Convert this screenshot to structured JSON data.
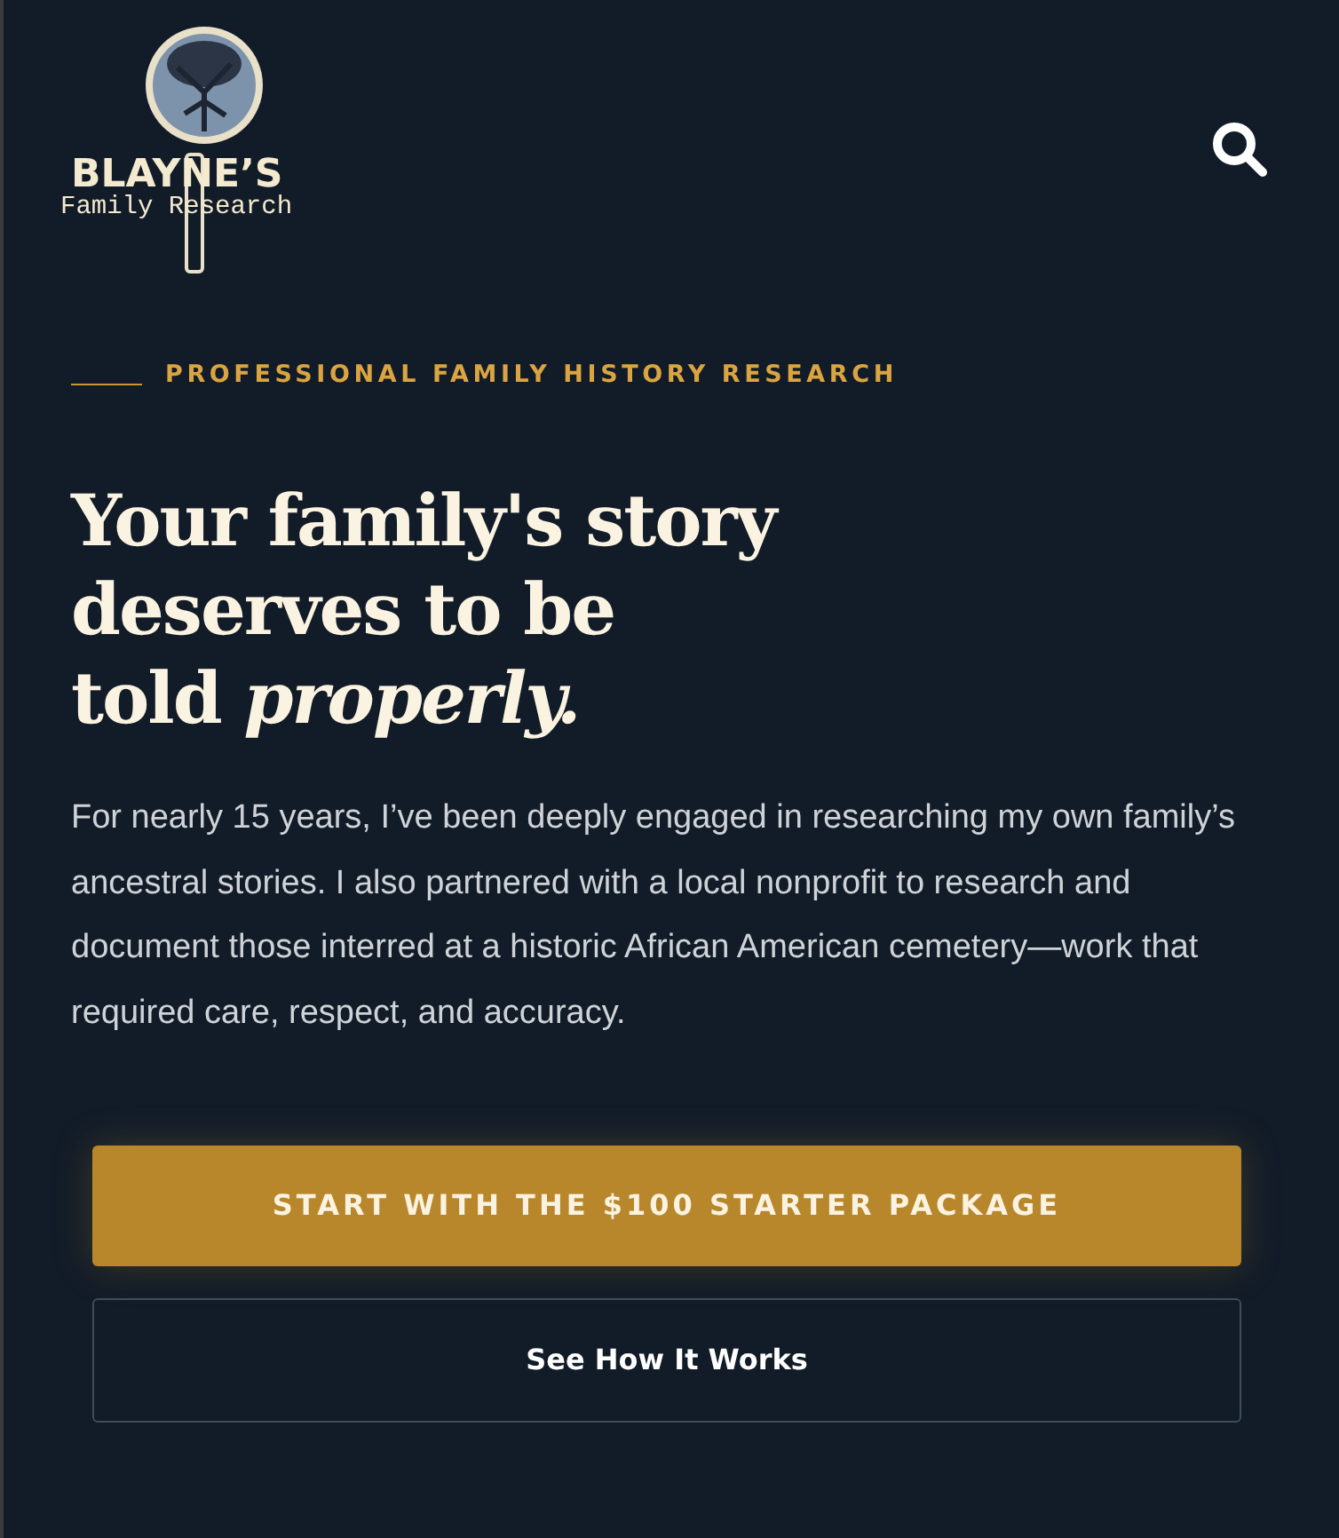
{
  "header": {
    "logo": {
      "title": "BLAYNE’S",
      "subtitle": "Family Research"
    }
  },
  "hero": {
    "kicker": "PROFESSIONAL FAMILY HISTORY RESEARCH",
    "headline": [
      "Your family's story",
      "deserves to be",
      "told *properly.*"
    ],
    "text": "For nearly 15 years, I’ve been deeply engaged in researching my own family’s ancestral stories. I also partnered with a local nonprofit to research and document those interred at a historic African American cemetery—work that required care, respect, and accuracy.",
    "buttons": [
      {
        "label": "START WITH THE $100 STARTER PACKAGE",
        "kind": "primary"
      },
      {
        "label": "See How It Works",
        "kind": "outline"
      }
    ]
  }
}
